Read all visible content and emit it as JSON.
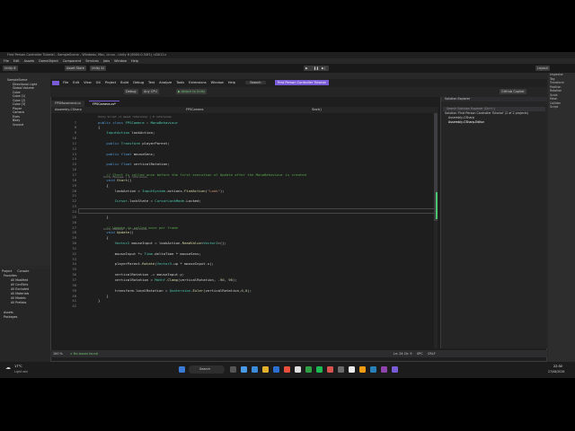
{
  "unity": {
    "title": "First Person Controller Tutorial - SampleScene - Windows, Mac, Linux - Unity 6 (6000.0.34f1) <DX11>",
    "menu": [
      "File",
      "Edit",
      "Assets",
      "GameObject",
      "Component",
      "Services",
      "Jobs",
      "Window",
      "Help"
    ],
    "toolbar": {
      "account": "Unity 6",
      "asset_store": "Asset Store",
      "unity_ai": "Unity AI",
      "layout": "Layout"
    },
    "hierarchy": [
      "SampleScene",
      "Directional Light",
      "Global Volume",
      "Cube",
      "Cube (1)",
      "Cube (2)",
      "Cube (3)",
      "Player",
      "Camera",
      "Eyes",
      "Body",
      "Ground"
    ],
    "project": {
      "tabs": [
        "Project",
        "Console"
      ],
      "items": [
        "Favorites",
        "All Modified",
        "All Conflicts",
        "All Excluded",
        "All Materials",
        "All Models",
        "All Prefabs",
        "Assets",
        "Packages"
      ]
    },
    "inspector": [
      "Inspector",
      "Tag",
      "Transform",
      "Position",
      "Rotation",
      "Scale",
      "Mesh",
      "Collider",
      "Script"
    ]
  },
  "vs": {
    "menu": [
      "File",
      "Edit",
      "View",
      "Git",
      "Project",
      "Build",
      "Debug",
      "Test",
      "Analyze",
      "Tools",
      "Extensions",
      "Window",
      "Help"
    ],
    "search": "Search",
    "project_title": "First Person Controller Tutorial",
    "config": "Debug",
    "platform": "Any CPU",
    "attach": "Attach to Unity",
    "copilot": "GitHub Copilot",
    "tabs": [
      {
        "label": "FPSMovement.cs"
      },
      {
        "label": "FPSCamera.cs*"
      }
    ],
    "navbar": {
      "project": "Assembly-CSharp",
      "class": "FPSCamera",
      "member": "Start()"
    },
    "code_lines": [
      {
        "n": "7",
        "hint": "",
        "text": "public class FPSCamera : MonoBehaviour"
      },
      {
        "n": "8",
        "hint": "",
        "text": "{"
      },
      {
        "n": "9",
        "hint": "",
        "text": "    InputAction lookAction;"
      },
      {
        "n": "10",
        "hint": "",
        "text": ""
      },
      {
        "n": "11",
        "hint": "",
        "text": "    public Transform playerParent;"
      },
      {
        "n": "12",
        "hint": "",
        "text": ""
      },
      {
        "n": "13",
        "hint": "",
        "text": "    public float mouseSens;"
      },
      {
        "n": "14",
        "hint": "",
        "text": ""
      },
      {
        "n": "15",
        "hint": "",
        "text": "    public float verticalRotation;"
      },
      {
        "n": "16",
        "hint": "",
        "text": ""
      },
      {
        "n": "17",
        "hint": "",
        "text": "    // Start is called once before the first execution of Update after the MonoBehaviour is created"
      },
      {
        "n": "18",
        "hint": "Unity Message | 0 references",
        "text": "    void Start()"
      },
      {
        "n": "19",
        "hint": "",
        "text": "    {"
      },
      {
        "n": "20",
        "hint": "",
        "text": "        lookAction = InputSystem.actions.FindAction(\"Look\");"
      },
      {
        "n": "21",
        "hint": "",
        "text": ""
      },
      {
        "n": "22",
        "hint": "",
        "text": "        Cursor.lockState = CursorLockMode.Locked;"
      },
      {
        "n": "23",
        "hint": "",
        "text": ""
      },
      {
        "n": "24",
        "hint": "",
        "text": "        "
      },
      {
        "n": "25",
        "hint": "",
        "text": "    }"
      },
      {
        "n": "26",
        "hint": "",
        "text": ""
      },
      {
        "n": "27",
        "hint": "",
        "text": "    // Update is called once per frame"
      },
      {
        "n": "28",
        "hint": "Unity Message | 0 references",
        "text": "    void Update()"
      },
      {
        "n": "29",
        "hint": "",
        "text": "    {"
      },
      {
        "n": "30",
        "hint": "",
        "text": "        Vector2 mouseInput = lookAction.ReadValue<Vector2>();"
      },
      {
        "n": "31",
        "hint": "",
        "text": ""
      },
      {
        "n": "32",
        "hint": "",
        "text": "        mouseInput *= Time.deltaTime * mouseSens;"
      },
      {
        "n": "33",
        "hint": "",
        "text": ""
      },
      {
        "n": "34",
        "hint": "",
        "text": "        playerParent.Rotate(Vector3.up * mouseInput.x);"
      },
      {
        "n": "35",
        "hint": "",
        "text": ""
      },
      {
        "n": "36",
        "hint": "",
        "text": "        verticalRotation -= mouseInput.y;"
      },
      {
        "n": "37",
        "hint": "",
        "text": "        verticalRotation = Mathf.Clamp(verticalRotation, -90, 90);"
      },
      {
        "n": "38",
        "hint": "",
        "text": ""
      },
      {
        "n": "39",
        "hint": "",
        "text": "        transform.localRotation = Quaternion.Euler(verticalRotation,0,0);"
      },
      {
        "n": "40",
        "hint": "",
        "text": "    }"
      },
      {
        "n": "41",
        "hint": "",
        "text": "}"
      },
      {
        "n": "42",
        "hint": "",
        "text": ""
      }
    ],
    "class_hint": "Unity Script (1 asset reference) | 0 references",
    "solution": {
      "title": "Solution Explorer",
      "search": "Search Solution Explorer (Ctrl+;)",
      "items": [
        "Solution 'First Person Controller Tutorial' (2 of 2 projects)",
        "Assembly-CSharp",
        "Assembly-CSharp-Editor"
      ]
    },
    "status": {
      "zoom": "100 %",
      "issues": "No issues found",
      "position": "Ln: 24  Ch: 9",
      "spc": "SPC",
      "crlf": "CRLF"
    }
  },
  "taskbar": {
    "weather_temp": "17°C",
    "weather_desc": "Light rain",
    "search": "Search",
    "time": "22:30",
    "date": "27/08/2026"
  }
}
